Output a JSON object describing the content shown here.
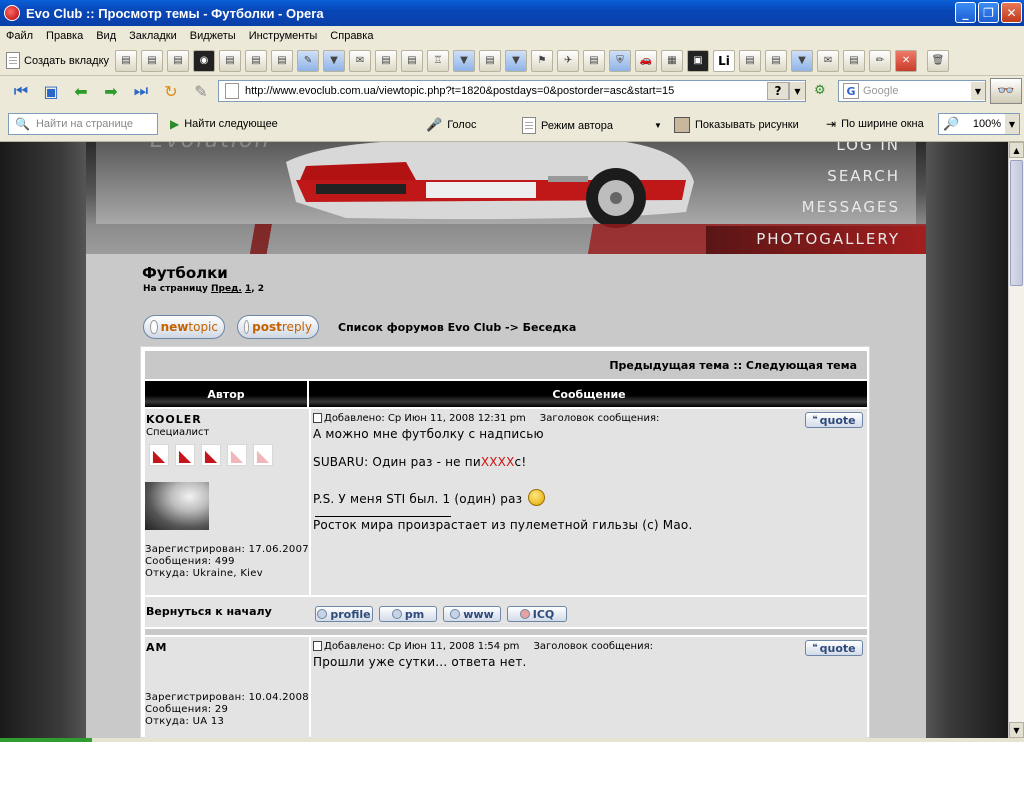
{
  "window": {
    "title": "Evo Club :: Просмотр темы - Футболки - Opera"
  },
  "menu": [
    "Файл",
    "Правка",
    "Вид",
    "Закладки",
    "Виджеты",
    "Инструменты",
    "Справка"
  ],
  "toolbar": {
    "new_tab": "Создать вкладку",
    "bookmark_li": "Li"
  },
  "address": {
    "url": "http://www.evoclub.com.ua/viewtopic.php?t=1820&postdays=0&postorder=asc&start=15",
    "help": "?"
  },
  "search": {
    "placeholder": "Google"
  },
  "findbar": {
    "placeholder": "Найти на странице",
    "find_next": "Найти следующее",
    "voice": "Голос",
    "author_mode": "Режим автора",
    "show_images": "Показывать рисунки",
    "fit_width": "По ширине окна",
    "zoom": "100%"
  },
  "site_nav": [
    "LOG IN",
    "SEARCH",
    "MESSAGES",
    "PHOTOGALLERY"
  ],
  "topic": {
    "title": "Футболки",
    "pages_prefix": "На страницу",
    "prev_link": "Пред.",
    "page1": "1",
    "sep": ",",
    "page2": "2"
  },
  "buttons": {
    "newtopic_a": "new",
    "newtopic_b": "topic",
    "postreply_a": "post",
    "postreply_b": "reply",
    "breadcrumb": "Список форумов Evo Club -> Беседка"
  },
  "table": {
    "prevnext": "Предыдущая тема :: Следующая тема",
    "col_author": "Автор",
    "col_message": "Сообщение"
  },
  "posts": [
    {
      "author": "KOOLER",
      "rank": "Специалист",
      "rank_stars_filled": 3,
      "rank_stars_total": 5,
      "registered": "Зарегистрирован: 17.06.2007",
      "messages": "Сообщения: 499",
      "from": "Откуда: Ukraine, Kiev",
      "posted": "Добавлено: Ср Июн 11, 2008 12:31 pm",
      "subject": "Заголовок сообщения:",
      "line1": "А можно мне футболку с надписью",
      "line2_a": "SUBARU: Один раз - не пи",
      "line2_red": "XXXX",
      "line2_b": "с!",
      "line3": "P.S. У меня STI был. 1 (один) раз",
      "signature": "Росток мира произрастает из пулеметной гильзы (с) Мао."
    },
    {
      "author": "AM",
      "registered": "Зарегистрирован: 10.04.2008",
      "messages": "Сообщения: 29",
      "from": "Откуда: UA 13",
      "posted": "Добавлено: Ср Июн 11, 2008 1:54 pm",
      "subject": "Заголовок сообщения:",
      "line1": "Прошли уже сутки... ответа нет."
    }
  ],
  "post_actions": {
    "back_to_top": "Вернуться к началу",
    "quote": "quote",
    "profile": "profile",
    "pm": "pm",
    "www": "www",
    "icq": "ICQ"
  },
  "colors": {
    "accent_red": "#c4141c",
    "button_text": "#c46200",
    "header_black": "#000000",
    "xp_blue": "#0a5fd8"
  }
}
